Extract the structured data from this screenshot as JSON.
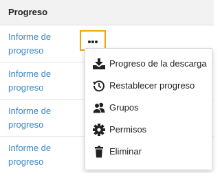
{
  "table": {
    "header": "Progreso",
    "rows": [
      {
        "link": "Informe de progreso"
      },
      {
        "link": "Informe de progreso"
      },
      {
        "link": "Informe de progreso"
      },
      {
        "link": "Informe de progreso"
      }
    ]
  },
  "more_button": {
    "label": "...",
    "icon": "more-horizontal-icon",
    "focus_color": "#f0a800"
  },
  "menu": {
    "items": [
      {
        "label": "Progreso de la descarga",
        "icon": "download-icon"
      },
      {
        "label": "Restablecer progreso",
        "icon": "history-icon"
      },
      {
        "label": "Grupos",
        "icon": "users-icon"
      },
      {
        "label": "Permisos",
        "icon": "gear-icon"
      },
      {
        "label": "Eliminar",
        "icon": "trash-icon"
      }
    ]
  },
  "colors": {
    "link": "#3a86c8",
    "text": "#222222",
    "header_background": "#f2f2f2"
  }
}
